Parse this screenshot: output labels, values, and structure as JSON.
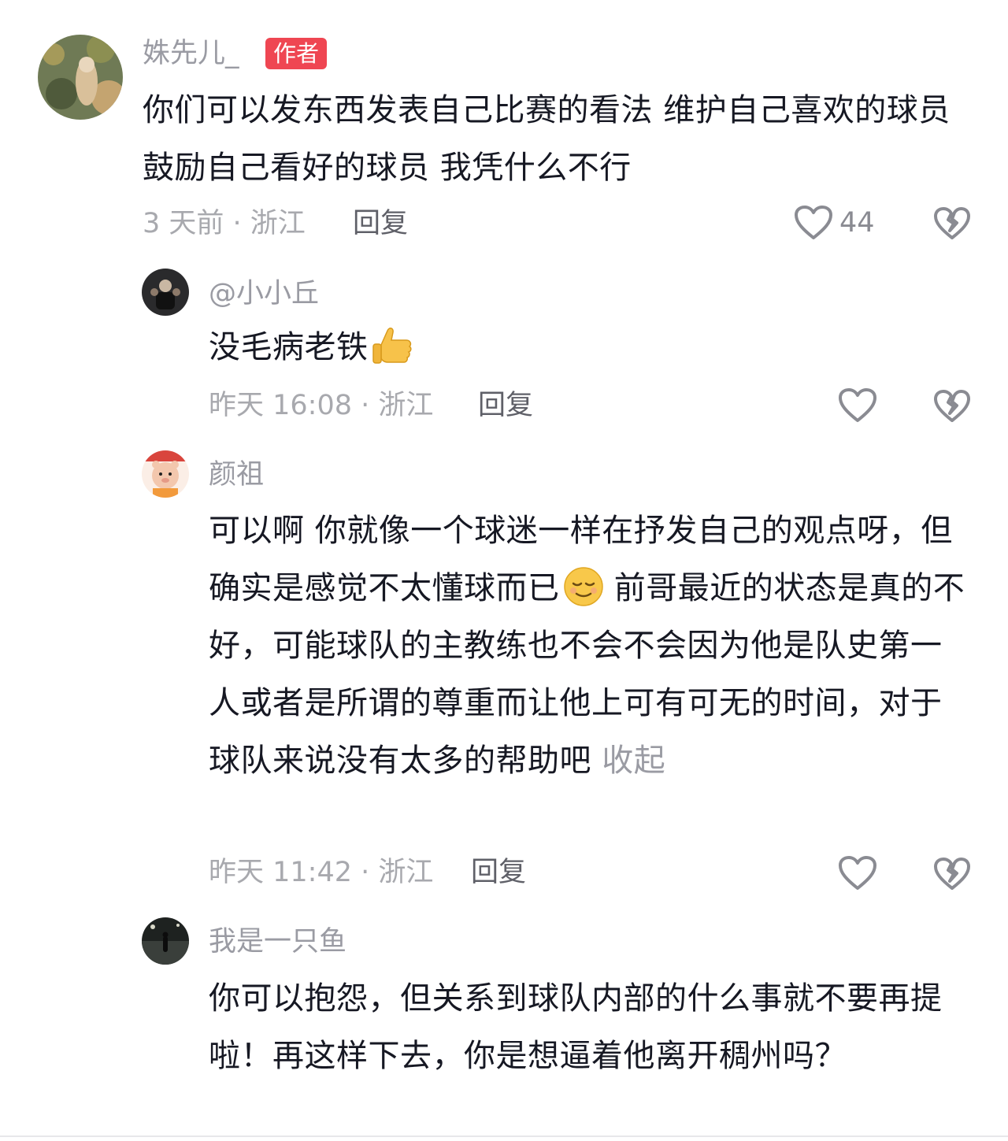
{
  "comments": [
    {
      "author": "姝先儿_",
      "badge": "作者",
      "text": "你们可以发东西发表自己比赛的看法 维护自己喜欢的球员 鼓励自己看好的球员 我凭什么不行",
      "meta": "3 天前 · 浙江",
      "reply_label": "回复",
      "like_count": "44",
      "accent": "#ef4652"
    }
  ],
  "replies": [
    {
      "author": "@小小丘",
      "text": "没毛病老铁",
      "meta": "昨天 16:08 · 浙江",
      "reply_label": "回复"
    },
    {
      "author": "颜祖",
      "text": "可以啊 你就像一个球迷一样在抒发自己的观点呀，但确实是感觉不太懂球而已",
      "text_continued": " 前哥最近的状态是真的不好，可能球队的主教练也不会不会因为他是队史第一人或者是所谓的尊重而让他上可有可无的时间，对于球队来说没有太多的帮助吧",
      "collapse_label": "收起",
      "meta": "昨天 11:42 · 浙江",
      "reply_label": "回复"
    },
    {
      "author": "我是一只鱼",
      "text": "你可以抱怨，但关系到球队内部的什么事就不要再提啦！再这样下去，你是想逼着他离开稠州吗？"
    }
  ],
  "icons": {
    "like": "heart-outline-icon",
    "dislike": "broken-heart-icon",
    "thumbs_up_emoji": "thumbs-up-emoji",
    "relieved_emoji": "relieved-face-emoji"
  }
}
